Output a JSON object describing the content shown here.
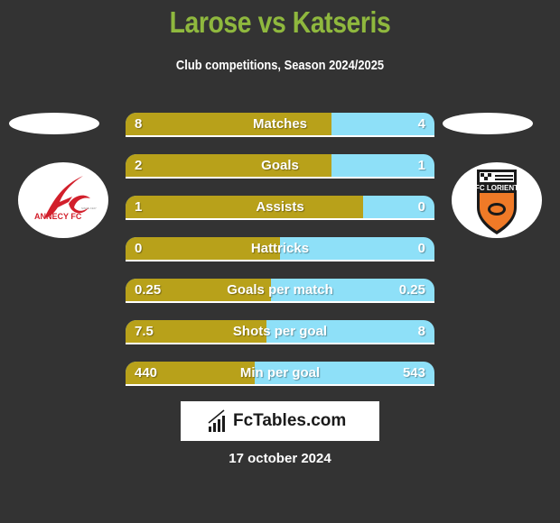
{
  "header": {
    "title": "Larose vs Katseris",
    "subtitle": "Club competitions, Season 2024/2025"
  },
  "teams": {
    "left": {
      "name": "Annecy FC",
      "logo_text": "ANNECY FC",
      "logo_small": "SINCE 1927",
      "logo_color": "#d21f2b"
    },
    "right": {
      "name": "FC Lorient",
      "logo_text": "FC LORIENT",
      "logo_color": "#f07a27"
    }
  },
  "colors": {
    "left_bar": "#b8a11a",
    "right_bar": "#8ee0f8",
    "title": "#8fb83e",
    "background": "#333333"
  },
  "stats": [
    {
      "label": "Matches",
      "left": "8",
      "right": "4",
      "left_share": 0.667
    },
    {
      "label": "Goals",
      "left": "2",
      "right": "1",
      "left_share": 0.667
    },
    {
      "label": "Assists",
      "left": "1",
      "right": "0",
      "left_share": 0.77
    },
    {
      "label": "Hattricks",
      "left": "0",
      "right": "0",
      "left_share": 0.5
    },
    {
      "label": "Goals per match",
      "left": "0.25",
      "right": "0.25",
      "left_share": 0.47
    },
    {
      "label": "Shots per goal",
      "left": "7.5",
      "right": "8",
      "left_share": 0.455
    },
    {
      "label": "Min per goal",
      "left": "440",
      "right": "543",
      "left_share": 0.417
    }
  ],
  "brand": {
    "text": "FcTables.com",
    "icon": "bar-chart-icon"
  },
  "footer": {
    "date": "17 october 2024"
  }
}
